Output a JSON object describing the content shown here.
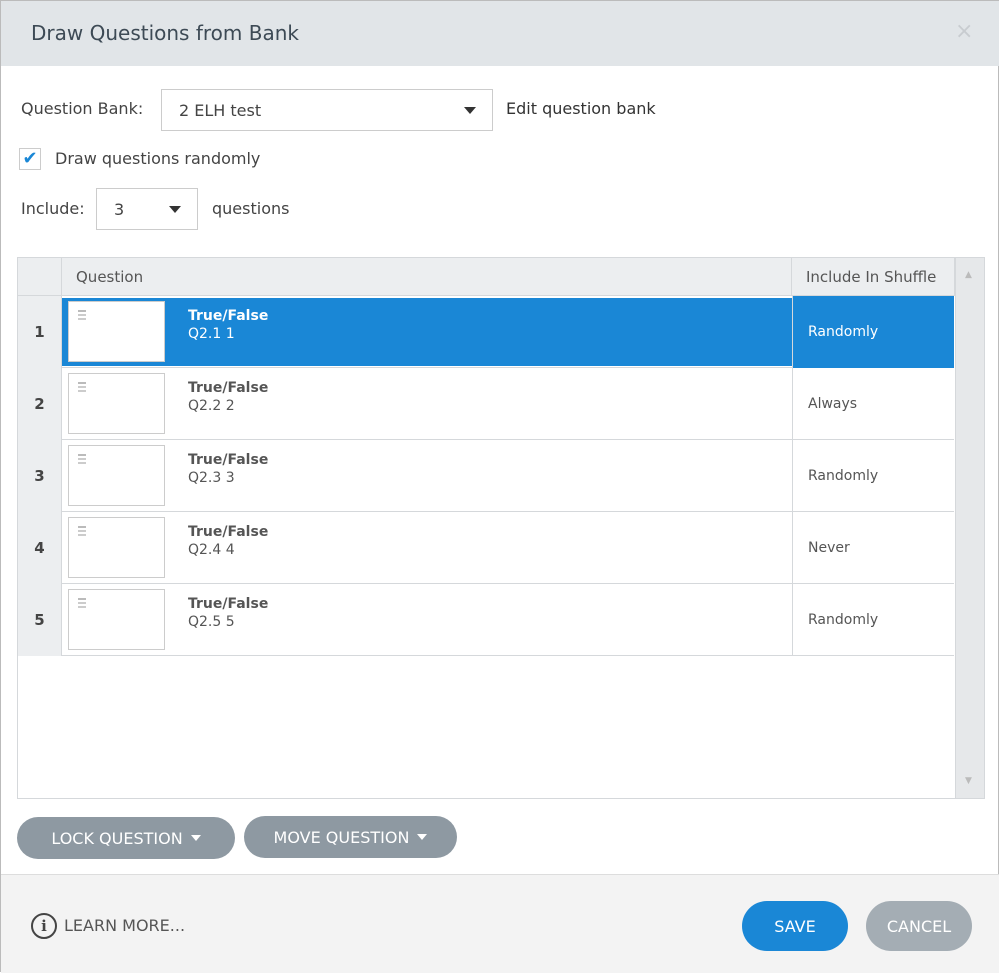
{
  "dialog": {
    "title": "Draw Questions from Bank",
    "close_icon": "×"
  },
  "bank": {
    "label": "Question Bank:",
    "value": "2 ELH test",
    "edit_link": "Edit question bank"
  },
  "random": {
    "label": "Draw questions randomly",
    "checked": true
  },
  "include": {
    "label": "Include:",
    "value": "3",
    "suffix": "questions"
  },
  "table": {
    "headers": [
      "Question",
      "Include In Shuffle"
    ],
    "rows": [
      {
        "num": "1",
        "type": "True/False",
        "name": "Q2.1 1",
        "shuffle": "Randomly",
        "selected": true
      },
      {
        "num": "2",
        "type": "True/False",
        "name": "Q2.2 2",
        "shuffle": "Always"
      },
      {
        "num": "3",
        "type": "True/False",
        "name": "Q2.3 3",
        "shuffle": "Randomly"
      },
      {
        "num": "4",
        "type": "True/False",
        "name": "Q2.4 4",
        "shuffle": "Never"
      },
      {
        "num": "5",
        "type": "True/False",
        "name": "Q2.5 5",
        "shuffle": "Randomly"
      }
    ]
  },
  "actions": {
    "lock": "LOCK QUESTION",
    "move": "MOVE QUESTION"
  },
  "footer": {
    "learn_more": "LEARN MORE...",
    "save": "SAVE",
    "cancel": "CANCEL"
  },
  "colors": {
    "accent": "#1a87d6",
    "gray_button": "#8e99a2"
  }
}
